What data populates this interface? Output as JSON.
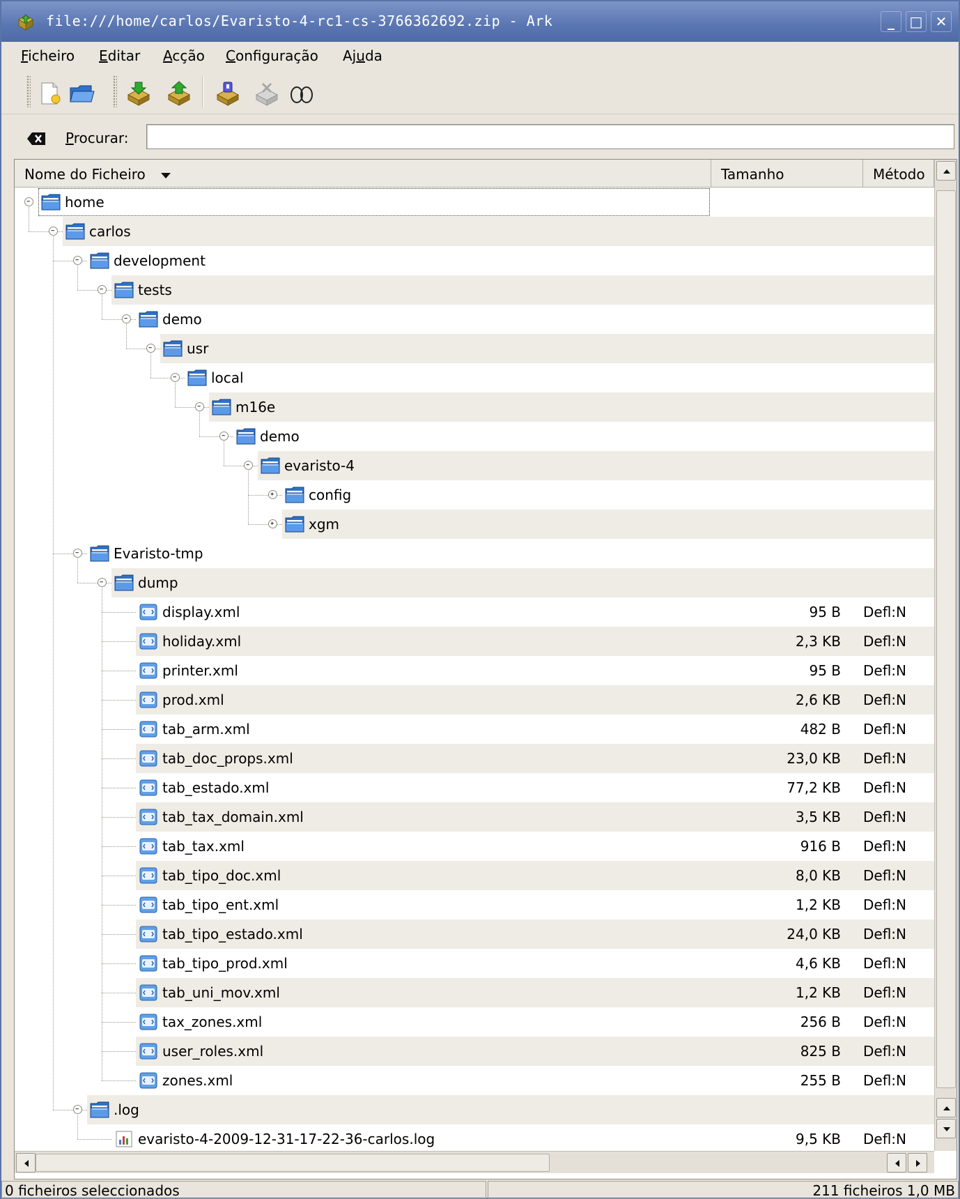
{
  "window": {
    "title": "file:///home/carlos/Evaristo-4-rc1-cs-3766362692.zip - Ark",
    "minimize_icon": "minimize-icon",
    "maximize_icon": "maximize-icon",
    "close_icon": "close-icon"
  },
  "menubar": {
    "items": [
      {
        "u": "F",
        "rest": "icheiro"
      },
      {
        "u": "E",
        "rest": "ditar"
      },
      {
        "u": "A",
        "rest": "cção"
      },
      {
        "u": "C",
        "rest": "onfiguração"
      },
      {
        "pre": "Aj",
        "u": "u",
        "rest": "da"
      }
    ]
  },
  "toolbar": {
    "icons": [
      "new-archive-icon",
      "open-archive-icon",
      "extract-icon",
      "add-files-icon",
      "add-folder-icon",
      "delete-icon",
      "view-icon"
    ]
  },
  "search": {
    "label_u": "P",
    "label_rest": "rocurar:",
    "value": ""
  },
  "columns": [
    "Nome do Ficheiro",
    "Tamanho",
    "Método"
  ],
  "tree": [
    {
      "depth": 0,
      "name": "home",
      "type": "folder",
      "expanded": true
    },
    {
      "depth": 1,
      "name": "carlos",
      "type": "folder",
      "expanded": true
    },
    {
      "depth": 2,
      "name": "development",
      "type": "folder",
      "expanded": true
    },
    {
      "depth": 3,
      "name": "tests",
      "type": "folder",
      "expanded": true
    },
    {
      "depth": 4,
      "name": "demo",
      "type": "folder",
      "expanded": true
    },
    {
      "depth": 5,
      "name": "usr",
      "type": "folder",
      "expanded": true
    },
    {
      "depth": 6,
      "name": "local",
      "type": "folder",
      "expanded": true
    },
    {
      "depth": 7,
      "name": "m16e",
      "type": "folder",
      "expanded": true
    },
    {
      "depth": 8,
      "name": "demo",
      "type": "folder",
      "expanded": true
    },
    {
      "depth": 9,
      "name": "evaristo-4",
      "type": "folder",
      "expanded": true
    },
    {
      "depth": 10,
      "name": "config",
      "type": "folder",
      "expanded": false
    },
    {
      "depth": 10,
      "name": "xgm",
      "type": "folder",
      "expanded": false
    },
    {
      "depth": 2,
      "name": "Evaristo-tmp",
      "type": "folder",
      "expanded": true
    },
    {
      "depth": 3,
      "name": "dump",
      "type": "folder",
      "expanded": true
    },
    {
      "depth": 4,
      "name": "display.xml",
      "type": "xml",
      "size": "95 B",
      "method": "Defl:N"
    },
    {
      "depth": 4,
      "name": "holiday.xml",
      "type": "xml",
      "size": "2,3 KB",
      "method": "Defl:N"
    },
    {
      "depth": 4,
      "name": "printer.xml",
      "type": "xml",
      "size": "95 B",
      "method": "Defl:N"
    },
    {
      "depth": 4,
      "name": "prod.xml",
      "type": "xml",
      "size": "2,6 KB",
      "method": "Defl:N"
    },
    {
      "depth": 4,
      "name": "tab_arm.xml",
      "type": "xml",
      "size": "482 B",
      "method": "Defl:N"
    },
    {
      "depth": 4,
      "name": "tab_doc_props.xml",
      "type": "xml",
      "size": "23,0 KB",
      "method": "Defl:N"
    },
    {
      "depth": 4,
      "name": "tab_estado.xml",
      "type": "xml",
      "size": "77,2 KB",
      "method": "Defl:N"
    },
    {
      "depth": 4,
      "name": "tab_tax_domain.xml",
      "type": "xml",
      "size": "3,5 KB",
      "method": "Defl:N"
    },
    {
      "depth": 4,
      "name": "tab_tax.xml",
      "type": "xml",
      "size": "916 B",
      "method": "Defl:N"
    },
    {
      "depth": 4,
      "name": "tab_tipo_doc.xml",
      "type": "xml",
      "size": "8,0 KB",
      "method": "Defl:N"
    },
    {
      "depth": 4,
      "name": "tab_tipo_ent.xml",
      "type": "xml",
      "size": "1,2 KB",
      "method": "Defl:N"
    },
    {
      "depth": 4,
      "name": "tab_tipo_estado.xml",
      "type": "xml",
      "size": "24,0 KB",
      "method": "Defl:N"
    },
    {
      "depth": 4,
      "name": "tab_tipo_prod.xml",
      "type": "xml",
      "size": "4,6 KB",
      "method": "Defl:N"
    },
    {
      "depth": 4,
      "name": "tab_uni_mov.xml",
      "type": "xml",
      "size": "1,2 KB",
      "method": "Defl:N"
    },
    {
      "depth": 4,
      "name": "tax_zones.xml",
      "type": "xml",
      "size": "256 B",
      "method": "Defl:N"
    },
    {
      "depth": 4,
      "name": "user_roles.xml",
      "type": "xml",
      "size": "825 B",
      "method": "Defl:N"
    },
    {
      "depth": 4,
      "name": "zones.xml",
      "type": "xml",
      "size": "255 B",
      "method": "Defl:N"
    },
    {
      "depth": 2,
      "name": ".log",
      "type": "folder",
      "expanded": true
    },
    {
      "depth": 3,
      "name": "evaristo-4-2009-12-31-17-22-36-carlos.log",
      "type": "log",
      "size": "9,5 KB",
      "method": "Defl:N"
    }
  ],
  "statusbar": {
    "selection": "0 ficheiros seleccionados",
    "summary": "211 ficheiros  1,0 MB"
  },
  "colors": {
    "titlebar": "#5a76b2",
    "folder": "#3d7fd9",
    "alt_row": "#efece5"
  }
}
